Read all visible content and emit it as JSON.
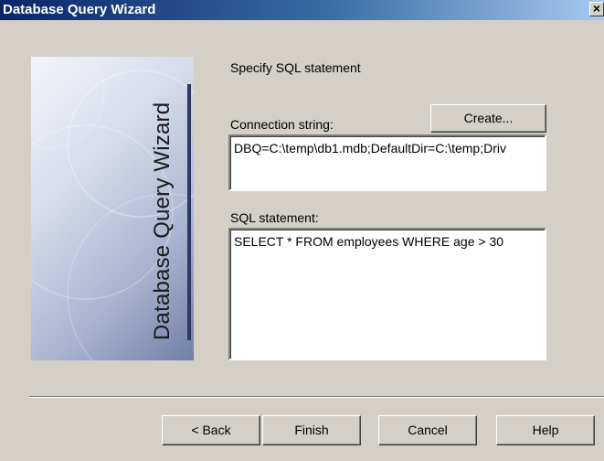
{
  "window": {
    "title": "Database Query Wizard",
    "close_glyph": "×"
  },
  "side_panel": {
    "title": "Database Query Wizard"
  },
  "page": {
    "instruction": "Specify SQL statement"
  },
  "connection": {
    "label": "Connection string:",
    "value": "DBQ=C:\\temp\\db1.mdb;DefaultDir=C:\\temp;Driv",
    "create_label": "Create..."
  },
  "sql": {
    "label": "SQL statement:",
    "value": "SELECT * FROM employees WHERE age > 30"
  },
  "buttons": {
    "back": "< Back",
    "finish": "Finish",
    "cancel": "Cancel",
    "help": "Help"
  }
}
